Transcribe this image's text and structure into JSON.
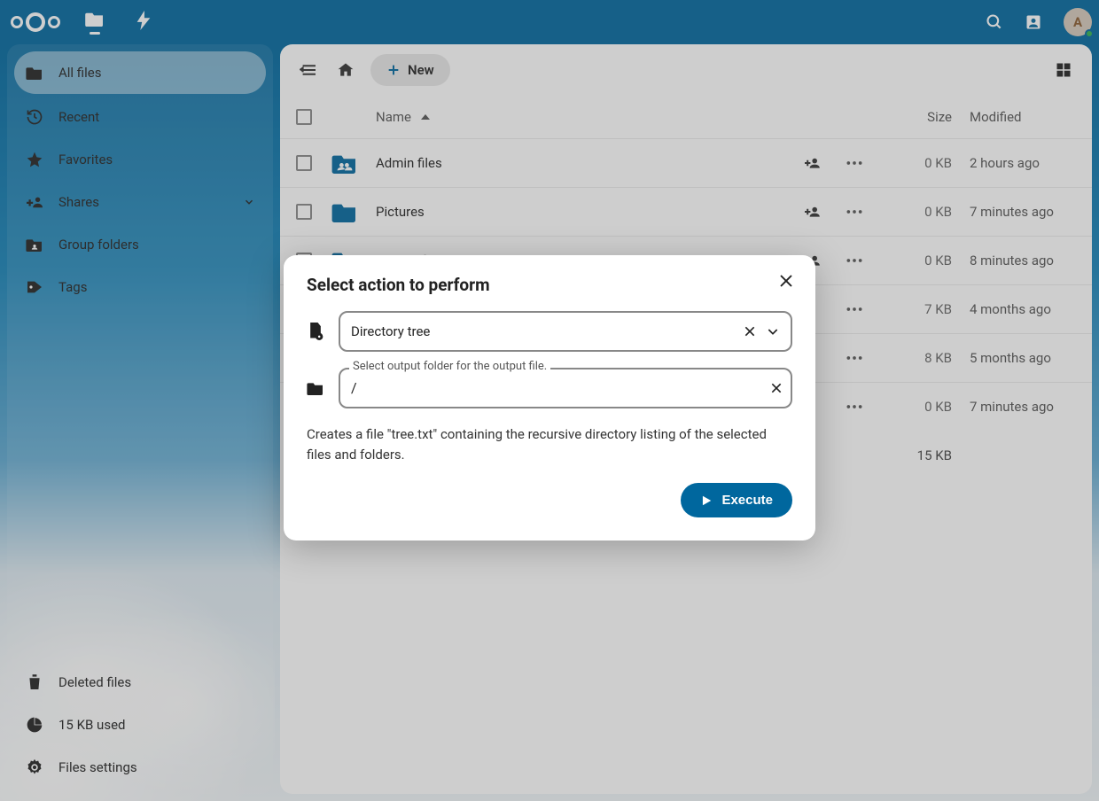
{
  "topbar": {
    "avatar_letter": "A"
  },
  "sidebar": {
    "all_files": "All files",
    "recent": "Recent",
    "favorites": "Favorites",
    "shares": "Shares",
    "group_folders": "Group folders",
    "tags": "Tags",
    "deleted": "Deleted files",
    "quota": "15 KB used",
    "settings": "Files settings"
  },
  "toolbar": {
    "new_label": "New"
  },
  "table": {
    "col_name": "Name",
    "col_size": "Size",
    "col_modified": "Modified",
    "rows": [
      {
        "name": "Admin files",
        "type": "shared-folder",
        "share": true,
        "size": "0 KB",
        "modified": "2 hours ago"
      },
      {
        "name": "Pictures",
        "type": "folder",
        "share": true,
        "size": "0 KB",
        "modified": "7 minutes ago"
      },
      {
        "name": "Project files",
        "type": "folder",
        "share": true,
        "size": "0 KB",
        "modified": "8 minutes ago"
      },
      {
        "name": "",
        "type": "file",
        "share": false,
        "size": "7 KB",
        "modified": "4 months ago"
      },
      {
        "name": "",
        "type": "file",
        "share": false,
        "size": "8 KB",
        "modified": "5 months ago"
      },
      {
        "name": "",
        "type": "file",
        "share": false,
        "size": "0 KB",
        "modified": "7 minutes ago"
      }
    ],
    "summary_size": "15 KB"
  },
  "modal": {
    "title": "Select action to perform",
    "action_value": "Directory tree",
    "output_label": "Select output folder for the output file.",
    "output_value": "/",
    "description": "Creates a file \"tree.txt\" containing the recursive directory listing of the selected files and folders.",
    "execute": "Execute"
  },
  "colors": {
    "primary": "#00679e"
  }
}
